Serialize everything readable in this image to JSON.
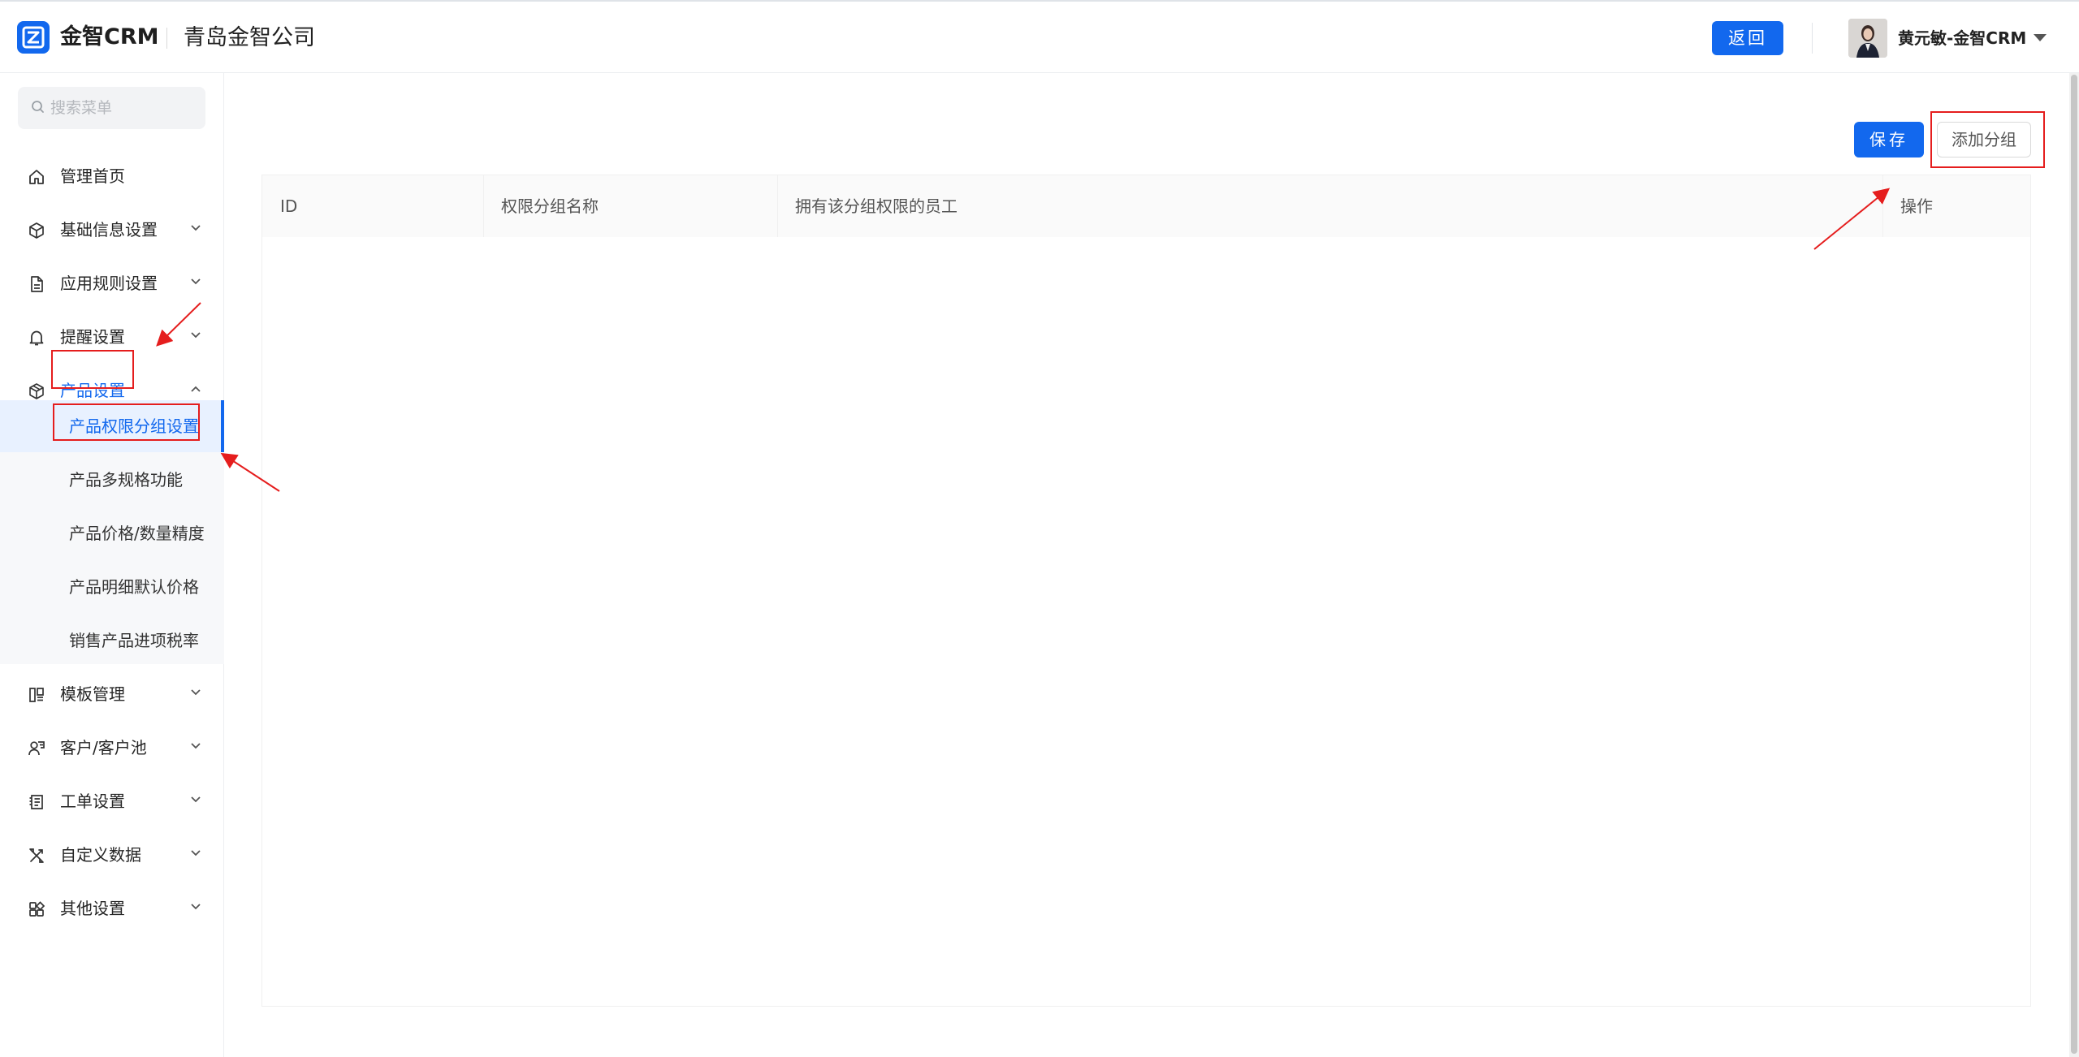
{
  "header": {
    "app_name": "金智CRM",
    "company": "青岛金智公司",
    "back_label": "返回",
    "user_name": "黄元敏-金智CRM"
  },
  "sidebar": {
    "search_placeholder": "搜索菜单",
    "items": [
      {
        "label": "管理首页",
        "icon": "home-icon",
        "expandable": false
      },
      {
        "label": "基础信息设置",
        "icon": "cube-icon",
        "expandable": true
      },
      {
        "label": "应用规则设置",
        "icon": "document-icon",
        "expandable": true
      },
      {
        "label": "提醒设置",
        "icon": "bell-icon",
        "expandable": true
      },
      {
        "label": "产品设置",
        "icon": "box-icon",
        "expandable": true,
        "expanded": true
      },
      {
        "label": "模板管理",
        "icon": "template-icon",
        "expandable": true
      },
      {
        "label": "客户/客户池",
        "icon": "customer-icon",
        "expandable": true
      },
      {
        "label": "工单设置",
        "icon": "ticket-icon",
        "expandable": true
      },
      {
        "label": "自定义数据",
        "icon": "tools-icon",
        "expandable": true
      },
      {
        "label": "其他设置",
        "icon": "apps-icon",
        "expandable": true
      }
    ],
    "product_subitems": [
      {
        "label": "产品权限分组设置",
        "selected": true
      },
      {
        "label": "产品多规格功能"
      },
      {
        "label": "产品价格/数量精度"
      },
      {
        "label": "产品明细默认价格"
      },
      {
        "label": "销售产品进项税率"
      }
    ]
  },
  "toolbar": {
    "save_label": "保存",
    "add_group_label": "添加分组"
  },
  "table": {
    "columns": [
      "ID",
      "权限分组名称",
      "拥有该分组权限的员工",
      "操作"
    ],
    "rows": []
  },
  "colors": {
    "accent": "#1268ee",
    "annotation": "#e51d1d"
  }
}
